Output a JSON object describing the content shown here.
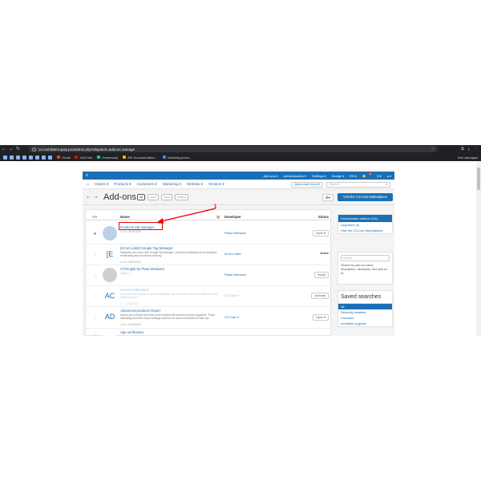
{
  "browser": {
    "url": "cs-cart455mv.piay.pro/admin.php?dispatch=addons.manage",
    "zoom": "1",
    "bookmarks": [
      "Gmail",
      "YouTube",
      "Grammarly",
      "API Documentation...",
      "loshinsky.pro/w..."
    ],
    "all_bookmarks": "Все закладки"
  },
  "topbar": {
    "items": [
      "Add-ons ▾",
      "Administration ▾",
      "Settings ▾",
      "Design ▾",
      "EN ▾",
      "$ ▾",
      "▴ ▾"
    ],
    "badge": "1"
  },
  "menubar": {
    "items": [
      "Orders ▾",
      "Products ▾",
      "Customers ▾",
      "Marketing ▾",
      "Website ▾",
      "Vendors ▾"
    ],
    "quick_start": "Quick start menu ▾",
    "search_placeholder": "Search"
  },
  "titlebar": {
    "title": "Add-ons",
    "filters": [
      "All",
      "none",
      "none",
      "Ad(ss)"
    ],
    "market_button": "Visit the CS-Cart Marketplace"
  },
  "table": {
    "headers": {
      "name": "Name",
      "developer": "Developer",
      "status": "Status"
    },
    "rows": [
      {
        "name": "Products tab manager",
        "desc": "",
        "meta": "1.0.0 • 09/19/2024",
        "developer": "Plata Webware",
        "status": "Open ▾",
        "status_type": "button",
        "icon_color": "#bcd0e6",
        "icon_label": "",
        "dim": false,
        "starred": true
      },
      {
        "name": "[eCom Labs] Google Tag Manager",
        "desc": "Integrates your store with Google Tag Manager • powerful marketing tool for analytics, remarketing and conversion tracking",
        "meta": "1.0.0 • 05/20/2024",
        "developer": "eCom Labs",
        "status": "Active",
        "status_type": "text",
        "icon_color": "#ffffff",
        "icon_label": "[E",
        "dim": false,
        "starred": false
      },
      {
        "name": "Al Penglai by Plata Webware",
        "desc": "",
        "meta": "1.0.0 • —",
        "developer": "Plata Webware",
        "status": "Install",
        "status_type": "button",
        "icon_color": "#cfcfcf",
        "icon_label": "",
        "dim": false,
        "starred": false
      },
      {
        "name": "Access restrictions",
        "desc": "Lets your store customers and administrator use it access to certain IP addresses with different options",
        "meta": "1.0 • 07/08/2024",
        "developer": "CS-Cart ✔",
        "status": "Activate",
        "status_type": "button",
        "icon_color": "#ffffff",
        "icon_label": "AC",
        "dim": true,
        "starred": false
      },
      {
        "name": "Advanced products import",
        "desc": "Allows you to match the fields in the imported file with the product properties. Those matchings and other import settings can then be saved as presets for later use.",
        "meta": "1.0.0 • 07/08/2024",
        "developer": "CS-Cart ✔",
        "status": "Open ▾",
        "status_type": "button",
        "icon_color": "#ffffff",
        "icon_label": "AD",
        "dim": false,
        "starred": false
      },
      {
        "name": "Age verification",
        "desc": "",
        "meta": "",
        "developer": "",
        "status": "",
        "status_type": "text",
        "icon_color": "#ffffff",
        "icon_label": "",
        "dim": false,
        "starred": false
      }
    ]
  },
  "sidebar": {
    "downloaded_header": "Downloaded addons (111)",
    "links1": [
      "Upgrades (0)",
      "Visit the CS-Cart Marketplace"
    ],
    "search_placeholder": "Search",
    "search_hint": "Search by add-on name, description, developer, and add-on ID.",
    "saved_title": "Saved searches",
    "saved_selected": "All",
    "saved_links": [
      "Recently installed",
      "Favorites",
      "Available upgrade"
    ]
  },
  "annotation": {
    "number": "1",
    "color": "#e00000"
  }
}
